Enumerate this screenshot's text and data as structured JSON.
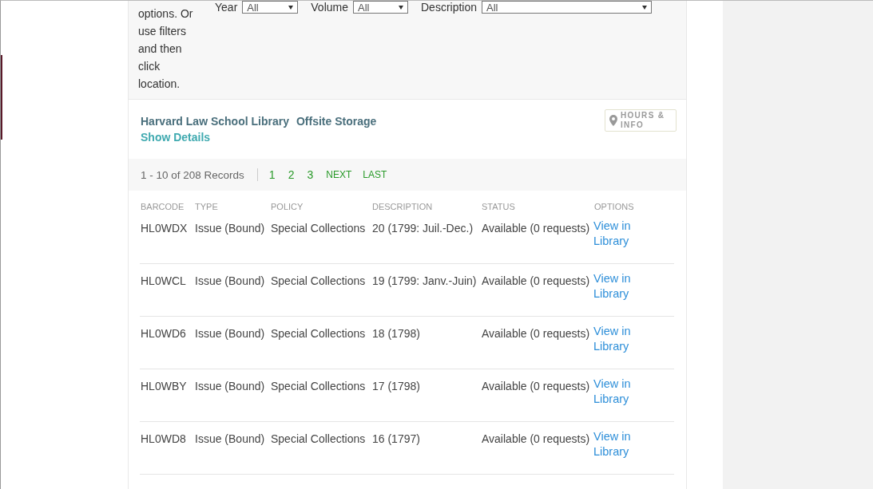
{
  "intro_text": "options. Or use filters and then click location.",
  "filters": [
    {
      "label": "Year",
      "value": "All"
    },
    {
      "label": "Volume",
      "value": "All"
    },
    {
      "label": "Description",
      "value": "All"
    }
  ],
  "location": {
    "library": "Harvard Law School Library",
    "collection": "Offsite Storage",
    "details_link": "Show Details",
    "hours_button": "HOURS & INFO"
  },
  "pagination": {
    "summary": "1 - 10 of 208 Records",
    "pages": [
      "1",
      "2",
      "3"
    ],
    "next": "NEXT",
    "last": "LAST"
  },
  "table": {
    "columns": [
      "BARCODE",
      "TYPE",
      "POLICY",
      "DESCRIPTION",
      "STATUS",
      "OPTIONS"
    ],
    "rows": [
      {
        "barcode": "HL0WDX",
        "type": "Issue (Bound)",
        "policy": "Special Collections",
        "description": "20 (1799: Juil.-Dec.)",
        "status": "Available (0 requests)",
        "option": "View in Library"
      },
      {
        "barcode": "HL0WCL",
        "type": "Issue (Bound)",
        "policy": "Special Collections",
        "description": "19 (1799: Janv.-Juin)",
        "status": "Available (0 requests)",
        "option": "View in Library"
      },
      {
        "barcode": "HL0WD6",
        "type": "Issue (Bound)",
        "policy": "Special Collections",
        "description": "18 (1798)",
        "status": "Available (0 requests)",
        "option": "View in Library"
      },
      {
        "barcode": "HL0WBY",
        "type": "Issue (Bound)",
        "policy": "Special Collections",
        "description": "17 (1798)",
        "status": "Available (0 requests)",
        "option": "View in Library"
      },
      {
        "barcode": "HL0WD8",
        "type": "Issue (Bound)",
        "policy": "Special Collections",
        "description": "16 (1797)",
        "status": "Available (0 requests)",
        "option": "View in Library"
      }
    ]
  }
}
